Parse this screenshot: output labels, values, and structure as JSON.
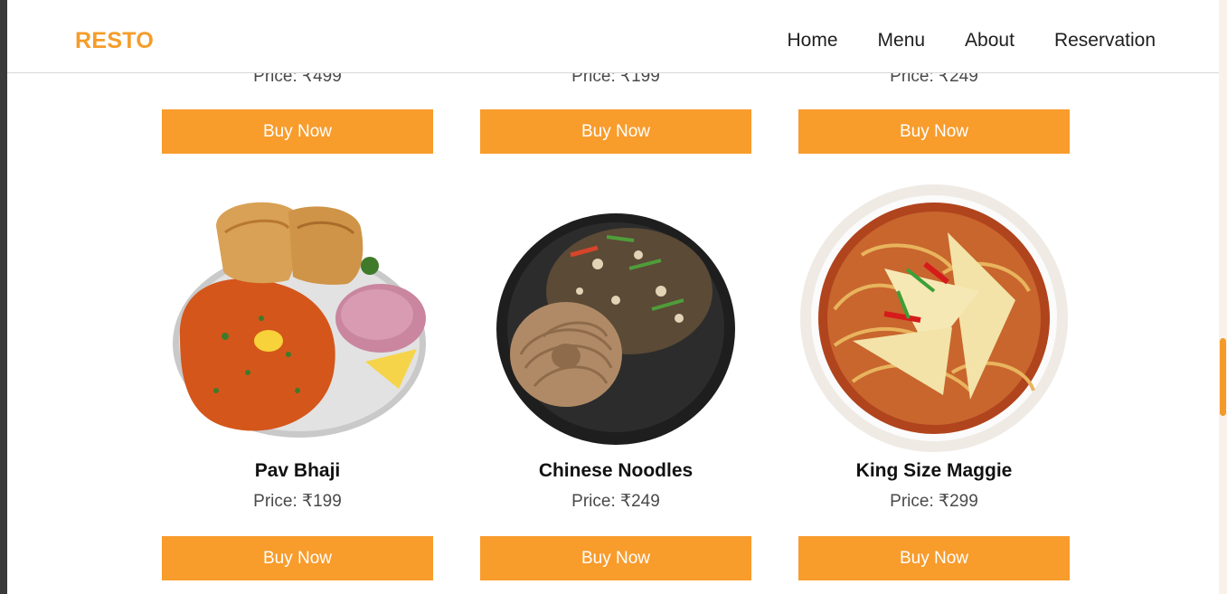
{
  "brand": "RESTO",
  "nav": {
    "home": "Home",
    "menu": "Menu",
    "about": "About",
    "reservation": "Reservation"
  },
  "previous_row": {
    "prices": [
      "Price: ₹499",
      "Price: ₹199",
      "Price: ₹249"
    ],
    "button_label": "Buy Now"
  },
  "dishes": [
    {
      "name": "Pav Bhaji",
      "price": "Price: ₹199",
      "button": "Buy Now"
    },
    {
      "name": "Chinese Noodles",
      "price": "Price: ₹249",
      "button": "Buy Now"
    },
    {
      "name": "King Size Maggie",
      "price": "Price: ₹299",
      "button": "Buy Now"
    }
  ],
  "colors": {
    "accent": "#f89c2c",
    "brand": "#f59c2a",
    "text": "#1f1f1f"
  }
}
